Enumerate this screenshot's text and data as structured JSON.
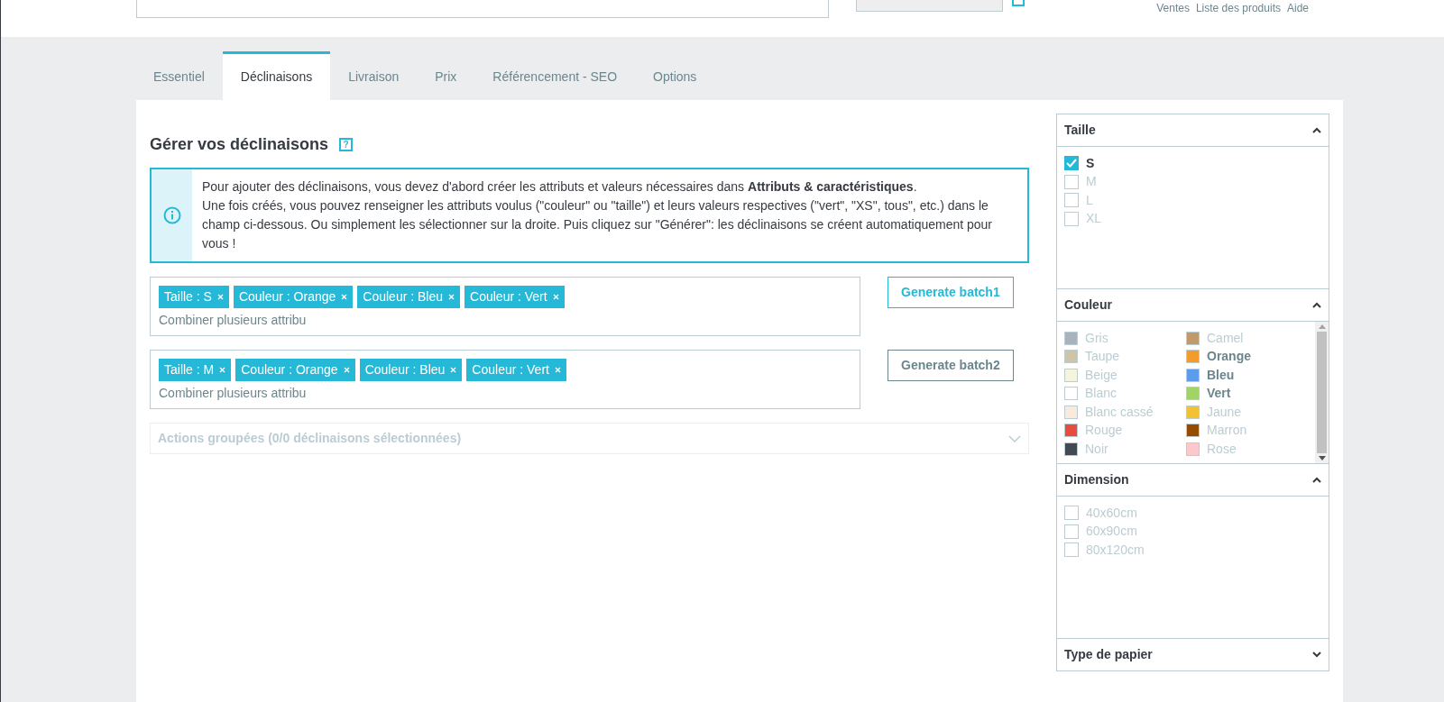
{
  "header": {
    "links": [
      "Ventes",
      "Liste des produits",
      "Aide"
    ]
  },
  "tabs": [
    {
      "label": "Essentiel",
      "selected": false
    },
    {
      "label": "Déclinaisons",
      "selected": true
    },
    {
      "label": "Livraison",
      "selected": false
    },
    {
      "label": "Prix",
      "selected": false
    },
    {
      "label": "Référencement - SEO",
      "selected": false
    },
    {
      "label": "Options",
      "selected": false
    }
  ],
  "section": {
    "title": "Gérer vos déclinaisons",
    "help": "?"
  },
  "info": {
    "paragraphs": [
      "Pour ajouter des déclinaisons, vous devez d'abord créer les attributs et valeurs nécessaires dans **Attributs & caractéristiques**.",
      "Une fois créés, vous pouvez renseigner les attributs voulus (\"couleur\" ou \"taille\") et leurs valeurs respectives (\"vert\", \"XS\", tous\", etc.) dans le champ ci-dessous. Ou simplement les sélectionner sur la droite. Puis cliquez sur \"Générer\": les déclinaisons se créent automatiquement pour vous !"
    ]
  },
  "batches": [
    {
      "tags": [
        "Taille : S",
        "Couleur : Orange",
        "Couleur : Bleu",
        "Couleur : Vert"
      ],
      "placeholder": "Combiner plusieurs attribu",
      "button": "Generate batch1",
      "selected": true
    },
    {
      "tags": [
        "Taille : M",
        "Couleur : Orange",
        "Couleur : Bleu",
        "Couleur : Vert"
      ],
      "placeholder": "Combiner plusieurs attribu",
      "button": "Generate batch2",
      "selected": false
    }
  ],
  "bulk_actions": {
    "label": "Actions groupées (0/0 déclinaisons sélectionnées)",
    "expanded": false
  },
  "attribute_groups": [
    {
      "title": "Taille",
      "expanded": true,
      "kind": "checkbox",
      "items": [
        {
          "label": "S",
          "checked": true
        },
        {
          "label": "M",
          "checked": false
        },
        {
          "label": "L",
          "checked": false
        },
        {
          "label": "XL",
          "checked": false
        }
      ]
    },
    {
      "title": "Couleur",
      "expanded": true,
      "kind": "color",
      "items": [
        {
          "label": "Gris",
          "color": "#aab2bd",
          "checked": false
        },
        {
          "label": "Camel",
          "color": "#c19a6b",
          "checked": false
        },
        {
          "label": "Taupe",
          "color": "#d0c4a8",
          "checked": false
        },
        {
          "label": "Orange",
          "color": "#f39c2b",
          "checked": true
        },
        {
          "label": "Beige",
          "color": "#f5f5dc",
          "checked": false
        },
        {
          "label": "Bleu",
          "color": "#5d9cec",
          "checked": true
        },
        {
          "label": "Blanc",
          "color": "#ffffff",
          "checked": false
        },
        {
          "label": "Vert",
          "color": "#a0d468",
          "checked": true
        },
        {
          "label": "Blanc cassé",
          "color": "#fbe9dc",
          "checked": false
        },
        {
          "label": "Jaune",
          "color": "#f1c232",
          "checked": false
        },
        {
          "label": "Rouge",
          "color": "#e84c3d",
          "checked": false
        },
        {
          "label": "Marron",
          "color": "#964b00",
          "checked": false
        },
        {
          "label": "Noir",
          "color": "#434a54",
          "checked": false
        },
        {
          "label": "Rose",
          "color": "#fcc8cc",
          "checked": false
        }
      ]
    },
    {
      "title": "Dimension",
      "expanded": true,
      "kind": "checkbox",
      "items": [
        {
          "label": "40x60cm",
          "checked": false
        },
        {
          "label": "60x90cm",
          "checked": false
        },
        {
          "label": "80x120cm",
          "checked": false
        }
      ]
    },
    {
      "title": "Type de papier",
      "expanded": false,
      "kind": "checkbox"
    }
  ]
}
